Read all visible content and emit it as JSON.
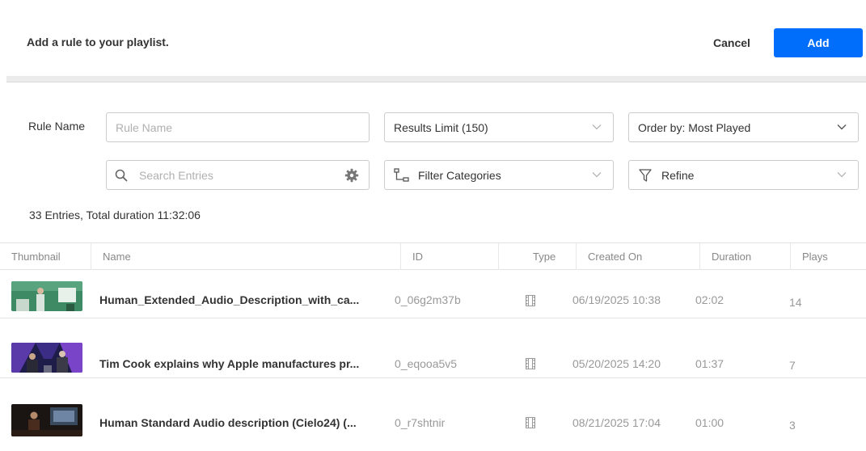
{
  "header": {
    "title": "Add a rule to your playlist.",
    "cancel_label": "Cancel",
    "add_label": "Add"
  },
  "form": {
    "rule_name_label": "Rule Name",
    "rule_name_placeholder": "Rule Name",
    "results_limit": "Results Limit (150)",
    "order_by": "Order by: Most Played",
    "search_placeholder": "Search Entries",
    "filter_categories": "Filter Categories",
    "refine": "Refine"
  },
  "summary": "33 Entries, Total duration 11:32:06",
  "table": {
    "columns": [
      "Thumbnail",
      "Name",
      "ID",
      "Type",
      "Created On",
      "Duration",
      "Plays"
    ],
    "rows": [
      {
        "name": "Human_Extended_Audio_Description_with_ca...",
        "id": "0_06g2m37b",
        "type_icon": "video-icon",
        "created": "06/19/2025 10:38",
        "duration": "02:02",
        "plays": "14"
      },
      {
        "name": "Tim Cook explains why Apple manufactures pr...",
        "id": "0_eqooa5v5",
        "type_icon": "video-icon",
        "created": "05/20/2025 14:20",
        "duration": "01:37",
        "plays": "7"
      },
      {
        "name": "Human Standard Audio description (Cielo24) (...",
        "id": "0_r7shtnir",
        "type_icon": "video-icon",
        "created": "08/21/2025 17:04",
        "duration": "01:00",
        "plays": "3"
      }
    ]
  },
  "colors": {
    "accent": "#006efa"
  }
}
